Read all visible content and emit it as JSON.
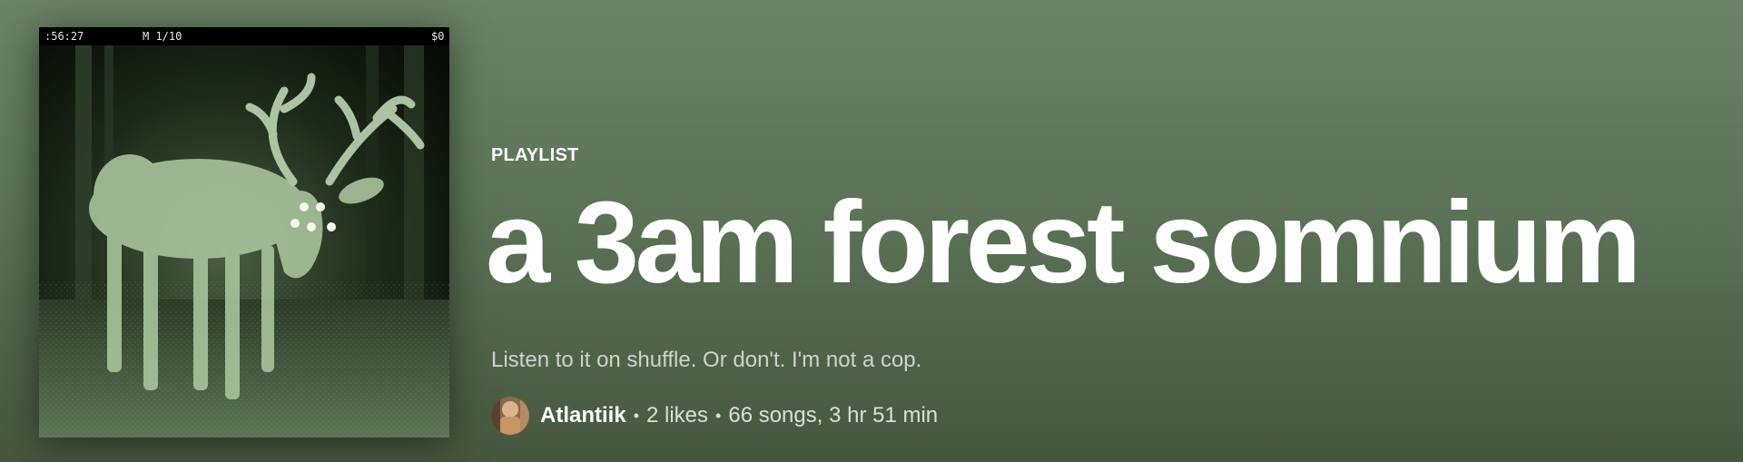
{
  "playlist": {
    "type_label": "PLAYLIST",
    "title": "a 3am forest somnium",
    "description": "Listen to it on shuffle. Or don't. I'm not a cop.",
    "owner": "Atlantiik",
    "separator": "•",
    "likes": "2 likes",
    "songs_duration": "66 songs, 3 hr 51 min"
  },
  "cover": {
    "cam_time": ":56:27",
    "cam_mode": "M 1/10",
    "cam_temp": "$0",
    "subject": "trail-camera-deer"
  },
  "colors": {
    "background_top": "#6b8366",
    "background_bottom": "#46573f",
    "text_primary": "#ffffff"
  }
}
